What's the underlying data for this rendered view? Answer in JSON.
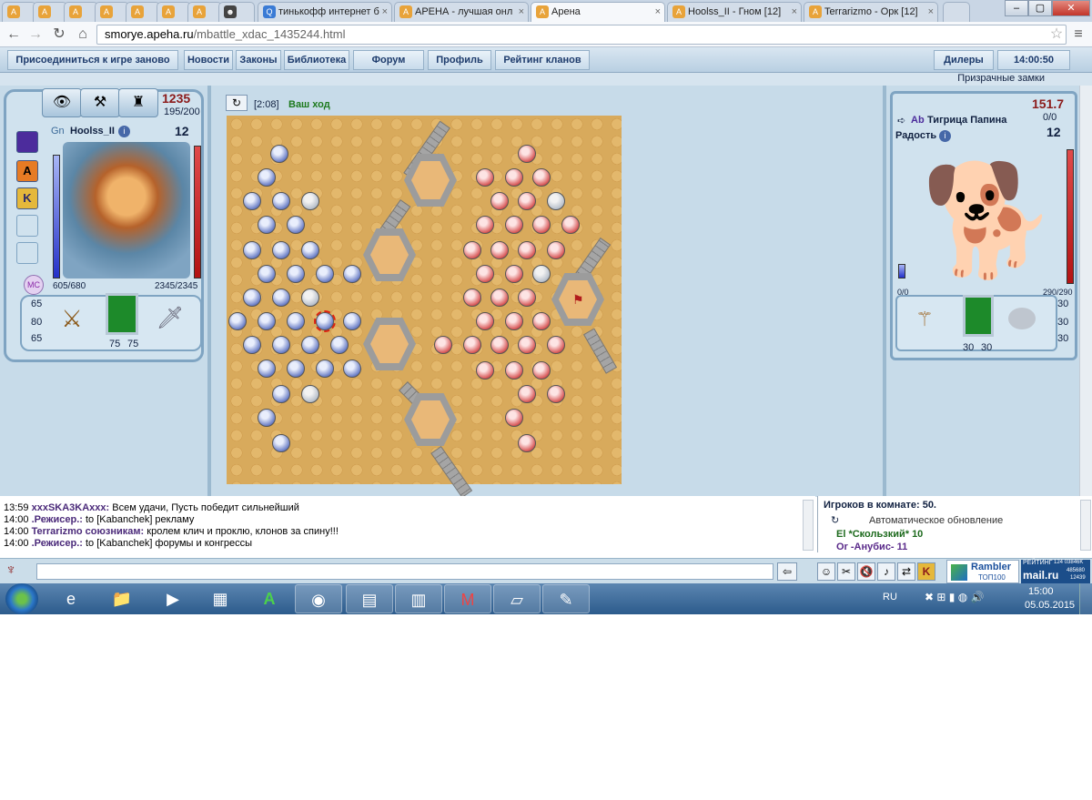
{
  "browser": {
    "tabs": [
      {
        "label": ""
      },
      {
        "label": ""
      },
      {
        "label": ""
      },
      {
        "label": ""
      },
      {
        "label": ""
      },
      {
        "label": ""
      },
      {
        "label": ""
      },
      {
        "label": ""
      },
      {
        "label": "тинькофф интернет б"
      },
      {
        "label": "АРЕНА - лучшая онл"
      },
      {
        "label": "Арена"
      },
      {
        "label": "Hoolss_II - Гном [12]"
      },
      {
        "label": "Terrarizmo - Орк [12]"
      }
    ],
    "address_domain": "smorye.apeha.ru",
    "address_path": "/mbattle_xdac_1435244.html"
  },
  "site_nav": {
    "items": [
      {
        "label": "Присоединиться к игре заново"
      },
      {
        "label": "Новости"
      },
      {
        "label": "Законы"
      },
      {
        "label": "Библиотека"
      },
      {
        "label": "Форум"
      },
      {
        "label": "Профиль"
      },
      {
        "label": "Рейтинг кланов"
      }
    ],
    "dealers": "Дилеры",
    "clock": "14:00:50",
    "sub": "Призрачные замки"
  },
  "player": {
    "rank": "Gn",
    "name": "Hoolss_II",
    "score": "1235",
    "energy": "195/200",
    "level": "12",
    "hp": "605/680",
    "mana": "2345/2345",
    "side_buttons": [
      "",
      "A",
      "K",
      "",
      ""
    ],
    "stats_left": [
      "65",
      "80",
      "65"
    ],
    "armor": [
      "75",
      "75"
    ]
  },
  "battle": {
    "timer": "[2:08]",
    "status": "Ваш ход"
  },
  "opponent": {
    "rank": "Ab",
    "name": "Тигрица Папина",
    "score": "151.7",
    "energy": "0/0",
    "mood": "Радость",
    "level": "12",
    "left_bar": "0/0",
    "hp": "290/290",
    "stats_right": [
      "30",
      "30",
      "30"
    ],
    "armor": [
      "30",
      "30"
    ]
  },
  "chat": {
    "messages": [
      {
        "time": "13:59",
        "name": "xxxSKA3KAxxx:",
        "text": "Всем удачи, Пусть победит сильнейший"
      },
      {
        "time": "14:00",
        "name": ".Режисер.:",
        "text": "to [Kabanchek] рекламу"
      },
      {
        "time": "14:00",
        "name": "Terrarizmo союзникам:",
        "text": "кролем клич и проклю, клонов за спину!!!"
      },
      {
        "time": "14:00",
        "name": ".Режисер.:",
        "text": "to [Kabanchek] форумы и конгрессы"
      }
    ]
  },
  "players_panel": {
    "count": "Игроков в комнате: 50.",
    "auto": "Автоматическое обновление",
    "p1": "El *Скользкий* 10",
    "p2": "Or -Анубис- 11"
  },
  "ads": {
    "rambler": "Rambler",
    "rambler_sub": "ТОП100",
    "rating": "РЕЙТИНГ",
    "mail": "mail.ru",
    "nums": [
      "124 03846K",
      "485680",
      "12439"
    ]
  },
  "taskbar": {
    "lang": "RU",
    "time": "15:00",
    "date": "05.05.2015"
  },
  "colors": {
    "accent": "#7fa4c2",
    "nav_text": "#1d3b6c",
    "blue_team": "#3b4fa0",
    "red_team": "#c23a3a"
  }
}
